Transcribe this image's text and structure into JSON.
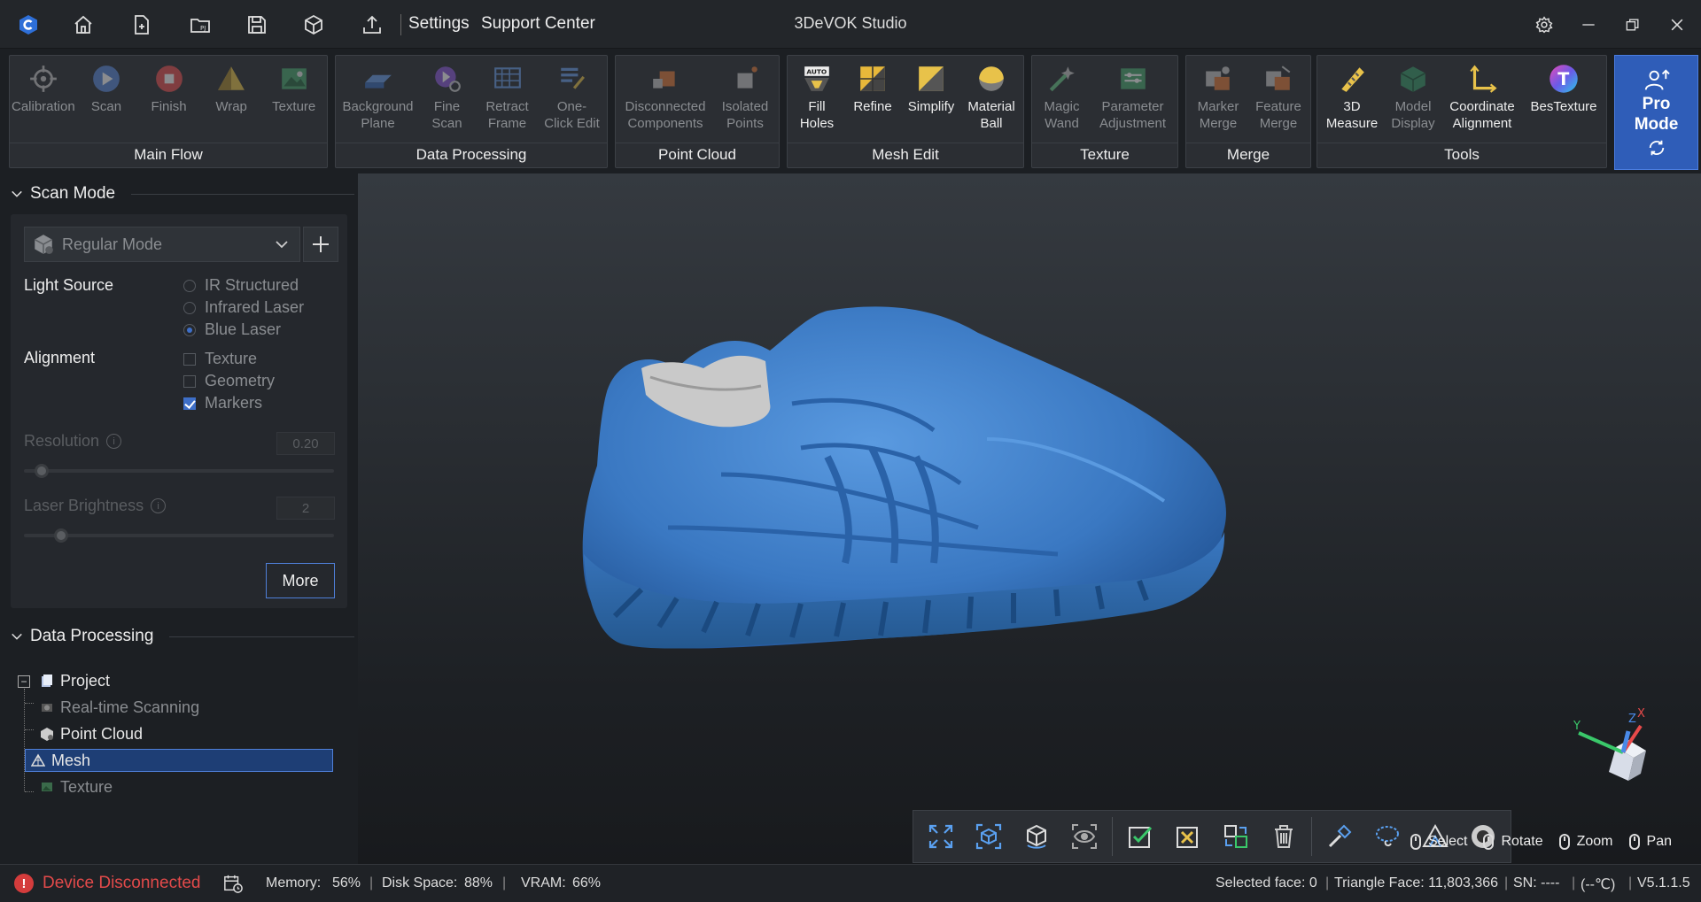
{
  "titlebar": {
    "app_title": "3DeVOK Studio",
    "menus": [
      "Settings",
      "Support Center"
    ],
    "icons": [
      "logo-icon",
      "home-icon",
      "new-project-icon",
      "open-project-icon",
      "save-icon",
      "import-icon",
      "export-icon"
    ],
    "window_buttons": [
      "settings-icon",
      "minimize-icon",
      "restore-icon",
      "close-icon"
    ]
  },
  "ribbon": {
    "groups": [
      {
        "name": "Main Flow",
        "items": [
          {
            "label": "Calibration",
            "icon": "calibration-icon",
            "enabled": false
          },
          {
            "label": "Scan",
            "icon": "scan-play-icon",
            "enabled": false
          },
          {
            "label": "Finish",
            "icon": "finish-stop-icon",
            "enabled": false
          },
          {
            "label": "Wrap",
            "icon": "wrap-icon",
            "enabled": false
          },
          {
            "label": "Texture",
            "icon": "texture-icon",
            "enabled": false
          }
        ]
      },
      {
        "name": "Data Processing",
        "items": [
          {
            "label": "Background\nPlane",
            "icon": "background-plane-icon",
            "enabled": false
          },
          {
            "label": "Fine\nScan",
            "icon": "fine-scan-icon",
            "enabled": false
          },
          {
            "label": "Retract\nFrame",
            "icon": "retract-frame-icon",
            "enabled": false
          },
          {
            "label": "One-\nClick Edit",
            "icon": "one-click-edit-icon",
            "enabled": false
          }
        ]
      },
      {
        "name": "Point Cloud",
        "items": [
          {
            "label": "Disconnected\nComponents",
            "icon": "disconnected-components-icon",
            "enabled": false
          },
          {
            "label": "Isolated\nPoints",
            "icon": "isolated-points-icon",
            "enabled": false
          }
        ]
      },
      {
        "name": "Mesh Edit",
        "items": [
          {
            "label": "Fill\nHoles",
            "icon": "fill-holes-icon",
            "enabled": true
          },
          {
            "label": "Refine",
            "icon": "refine-icon",
            "enabled": true
          },
          {
            "label": "Simplify",
            "icon": "simplify-icon",
            "enabled": true
          },
          {
            "label": "Material\nBall",
            "icon": "material-ball-icon",
            "enabled": true
          }
        ]
      },
      {
        "name": "Texture",
        "items": [
          {
            "label": "Magic\nWand",
            "icon": "magic-wand-icon",
            "enabled": false
          },
          {
            "label": "Parameter\nAdjustment",
            "icon": "parameter-adjustment-icon",
            "enabled": false
          }
        ]
      },
      {
        "name": "Merge",
        "items": [
          {
            "label": "Marker\nMerge",
            "icon": "marker-merge-icon",
            "enabled": false
          },
          {
            "label": "Feature\nMerge",
            "icon": "feature-merge-icon",
            "enabled": false
          }
        ]
      },
      {
        "name": "Tools",
        "items": [
          {
            "label": "3D\nMeasure",
            "icon": "measure-icon",
            "enabled": true
          },
          {
            "label": "Model\nDisplay",
            "icon": "model-display-icon",
            "enabled": false
          },
          {
            "label": "Coordinate\nAlignment",
            "icon": "coordinate-alignment-icon",
            "enabled": true
          },
          {
            "label": "BesTexture",
            "icon": "bestexture-icon",
            "enabled": true
          }
        ]
      }
    ],
    "pro_mode": {
      "label": "Pro\nMode"
    }
  },
  "scan_mode": {
    "title": "Scan Mode",
    "mode_value": "Regular Mode",
    "light_source_label": "Light Source",
    "light_sources": [
      {
        "label": "IR Structured",
        "selected": false
      },
      {
        "label": "Infrared Laser",
        "selected": false
      },
      {
        "label": "Blue Laser",
        "selected": true
      }
    ],
    "alignment_label": "Alignment",
    "alignments": [
      {
        "label": "Texture",
        "checked": false
      },
      {
        "label": "Geometry",
        "checked": false
      },
      {
        "label": "Markers",
        "checked": true
      }
    ],
    "resolution_label": "Resolution",
    "resolution_value": "0.20",
    "laser_brightness_label": "Laser Brightness",
    "laser_brightness_value": "2",
    "more_label": "More"
  },
  "data_processing": {
    "title": "Data Processing",
    "tree": [
      {
        "label": "Project",
        "icon": "project-icon",
        "state": "normal"
      },
      {
        "label": "Real-time Scanning",
        "icon": "realtime-scanning-icon",
        "state": "dim"
      },
      {
        "label": "Point Cloud",
        "icon": "point-cloud-icon",
        "state": "normal"
      },
      {
        "label": "Mesh",
        "icon": "mesh-icon",
        "state": "selected"
      },
      {
        "label": "Texture",
        "icon": "texture-node-icon",
        "state": "dim"
      }
    ]
  },
  "viewport": {
    "model_color": "#3a78c2",
    "toolbar": [
      "fit-view-icon",
      "zoom-box-icon",
      "rotate-center-icon",
      "visibility-icon",
      "check-select-icon",
      "invert-select-icon",
      "swap-select-icon",
      "delete-icon",
      "brush-select-icon",
      "lasso-select-icon",
      "triangle-select-icon",
      "ring-select-icon"
    ],
    "axis_labels": {
      "x": "X",
      "y": "Y",
      "z": "Z"
    },
    "mouse_legend": [
      {
        "label": "Select",
        "icon": "mouse-left-icon"
      },
      {
        "label": "Rotate",
        "icon": "mouse-right-icon"
      },
      {
        "label": "Zoom",
        "icon": "mouse-wheel-icon"
      },
      {
        "label": "Pan",
        "icon": "mouse-middle-icon"
      }
    ]
  },
  "statusbar": {
    "device_status": "Device Disconnected",
    "memory_label": "Memory:",
    "memory_value": "56%",
    "disk_label": "Disk Space:",
    "disk_value": "88%",
    "vram_label": "VRAM:",
    "vram_value": "66%",
    "selected_face": "Selected face: 0",
    "triangle_face": "Triangle Face: 11,803,366",
    "sn": "SN: ----",
    "temperature": "(--℃)",
    "version": "V5.1.1.5"
  }
}
